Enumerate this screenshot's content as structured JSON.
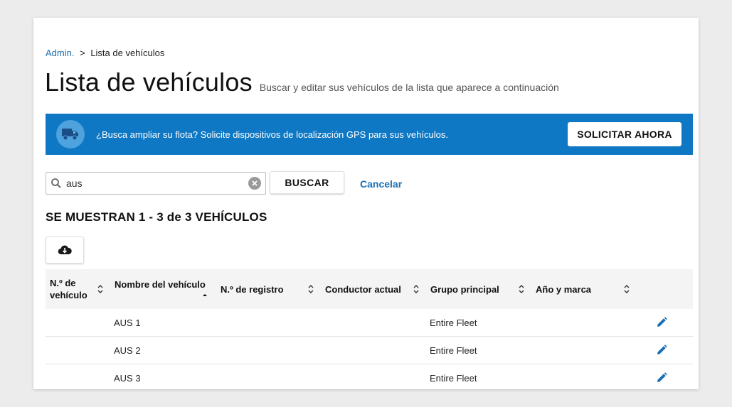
{
  "breadcrumb": {
    "parent": "Admin.",
    "separator": ">",
    "current": "Lista de vehículos"
  },
  "page": {
    "title": "Lista de vehículos",
    "subtitle": "Buscar y editar sus vehículos de la lista que aparece a continuación"
  },
  "banner": {
    "icon": "truck-icon",
    "text": "¿Busca ampliar su flota? Solicite dispositivos de localización GPS para sus vehículos.",
    "button_label": "SOLICITAR AHORA",
    "background_color": "#0f78c4"
  },
  "search": {
    "value": "aus",
    "search_button_label": "BUSCAR",
    "cancel_label": "Cancelar"
  },
  "results": {
    "count_label": "SE MUESTRAN 1 - 3 de 3 VEHÍCULOS",
    "download_icon": "cloud-download-icon"
  },
  "table": {
    "columns": [
      {
        "label_line1": "N.º de",
        "label_line2": "vehículo",
        "sort": "none"
      },
      {
        "label_line1": "Nombre del vehículo",
        "label_line2": "",
        "sort": "ascending"
      },
      {
        "label_line1": "N.º de registro",
        "label_line2": "",
        "sort": "none"
      },
      {
        "label_line1": "Conductor actual",
        "label_line2": "",
        "sort": "none"
      },
      {
        "label_line1": "Grupo principal",
        "label_line2": "",
        "sort": "none"
      },
      {
        "label_line1": "Año y marca",
        "label_line2": "",
        "sort": "none"
      }
    ],
    "rows": [
      {
        "vehicle_no": "",
        "name": "AUS 1",
        "registration": "",
        "driver": "",
        "group": "Entire Fleet",
        "year_make": ""
      },
      {
        "vehicle_no": "",
        "name": "AUS 2",
        "registration": "",
        "driver": "",
        "group": "Entire Fleet",
        "year_make": ""
      },
      {
        "vehicle_no": "",
        "name": "AUS 3",
        "registration": "",
        "driver": "",
        "group": "Entire Fleet",
        "year_make": ""
      }
    ]
  },
  "colors": {
    "accent": "#1a6fb3",
    "banner": "#0f78c4",
    "header_bg": "#f4f4f4"
  }
}
